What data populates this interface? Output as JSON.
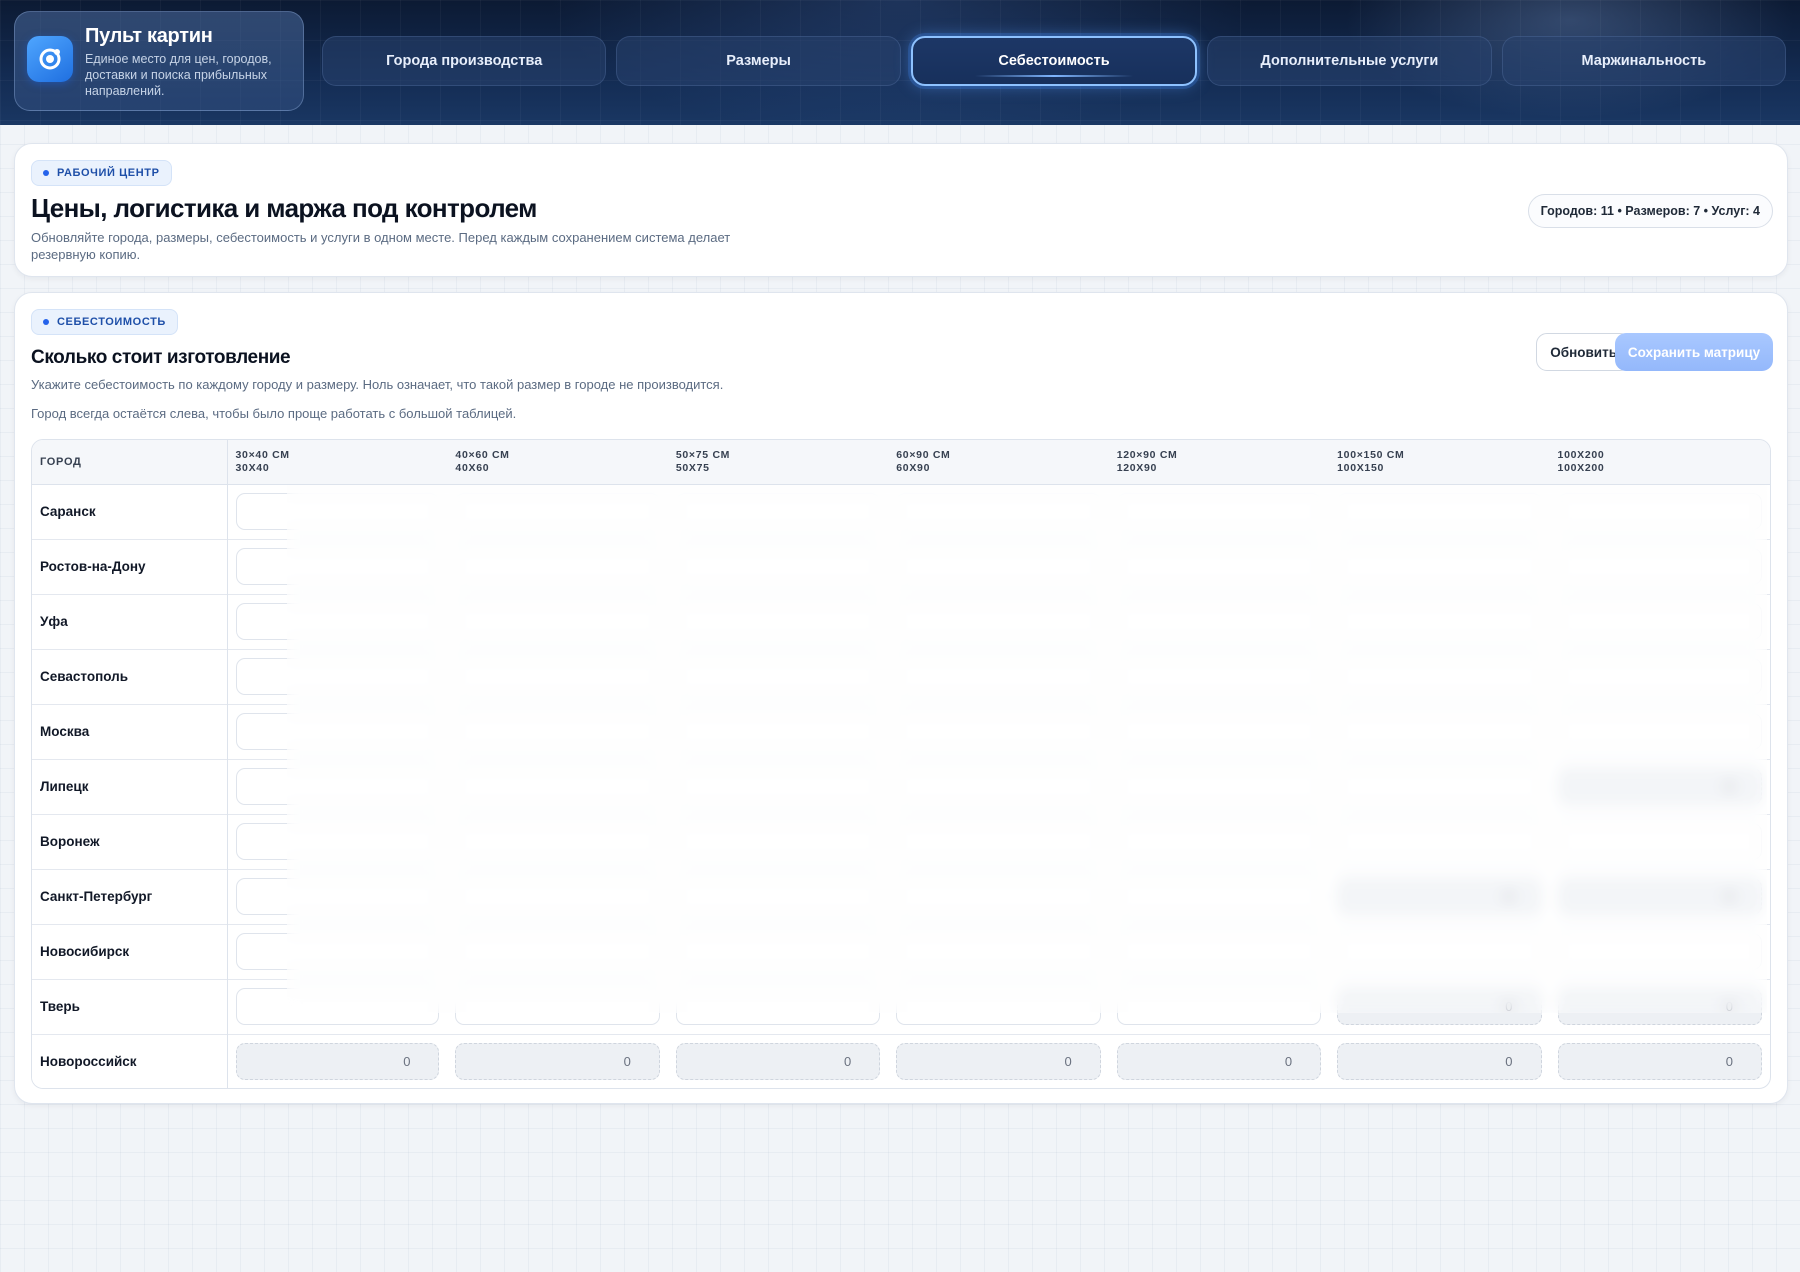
{
  "app": {
    "title": "Пульт картин",
    "subtitle": "Единое место для цен, городов, доставки и поиска прибыльных направлений."
  },
  "nav": {
    "tabs": [
      {
        "label": "Города производства",
        "active": false
      },
      {
        "label": "Размеры",
        "active": false
      },
      {
        "label": "Себестоимость",
        "active": true
      },
      {
        "label": "Дополнительные услуги",
        "active": false
      },
      {
        "label": "Маржинальность",
        "active": false
      }
    ]
  },
  "hero": {
    "badge": "РАБОЧИЙ ЦЕНТР",
    "title": "Цены, логистика и маржа под контролем",
    "description": "Обновляйте города, размеры, себестоимость и услуги в одном месте. Перед каждым сохранением система делает резервную копию.",
    "stats": "Городов: 11 • Размеров: 7 • Услуг: 4"
  },
  "section": {
    "badge": "СЕБЕСТОИМОСТЬ",
    "title": "Сколько стоит изготовление",
    "description": "Укажите себестоимость по каждому городу и размеру. Ноль означает, что такой размер в городе не производится.",
    "hint": "Город всегда остаётся слева, чтобы было проще работать с большой таблицей.",
    "refresh_label": "Обновить",
    "save_label": "Сохранить матрицу"
  },
  "table": {
    "city_header": "ГОРОД",
    "sizes": [
      {
        "label": "30×40 СМ",
        "code": "30X40"
      },
      {
        "label": "40×60 СМ",
        "code": "40X60"
      },
      {
        "label": "50×75 СМ",
        "code": "50X75"
      },
      {
        "label": "60×90 СМ",
        "code": "60X90"
      },
      {
        "label": "120×90 СМ",
        "code": "120X90"
      },
      {
        "label": "100×150 СМ",
        "code": "100X150"
      },
      {
        "label": "100X200",
        "code": "100X200"
      }
    ],
    "rows": [
      {
        "city": "Саранск",
        "values": [
          "",
          "",
          "",
          "",
          "",
          "",
          ""
        ]
      },
      {
        "city": "Ростов-на-Дону",
        "values": [
          "",
          "",
          "",
          "",
          "",
          "",
          ""
        ]
      },
      {
        "city": "Уфа",
        "values": [
          "",
          "",
          "",
          "",
          "",
          "",
          ""
        ]
      },
      {
        "city": "Севастополь",
        "values": [
          "",
          "",
          "",
          "",
          "",
          "",
          ""
        ]
      },
      {
        "city": "Москва",
        "values": [
          "",
          "",
          "",
          "",
          "",
          "",
          ""
        ]
      },
      {
        "city": "Липецк",
        "values": [
          "",
          "",
          "",
          "",
          "",
          "",
          "0"
        ]
      },
      {
        "city": "Воронеж",
        "values": [
          "",
          "",
          "",
          "",
          "",
          "",
          ""
        ]
      },
      {
        "city": "Санкт-Петербург",
        "values": [
          "",
          "",
          "",
          "",
          "",
          "0",
          "0"
        ]
      },
      {
        "city": "Новосибирск",
        "values": [
          "",
          "",
          "",
          "",
          "",
          "",
          ""
        ]
      },
      {
        "city": "Тверь",
        "values": [
          "",
          "",
          "",
          "",
          "",
          "0",
          "0"
        ]
      },
      {
        "city": "Новороссийск",
        "values": [
          "0",
          "0",
          "0",
          "0",
          "0",
          "0",
          "0"
        ]
      }
    ]
  }
}
